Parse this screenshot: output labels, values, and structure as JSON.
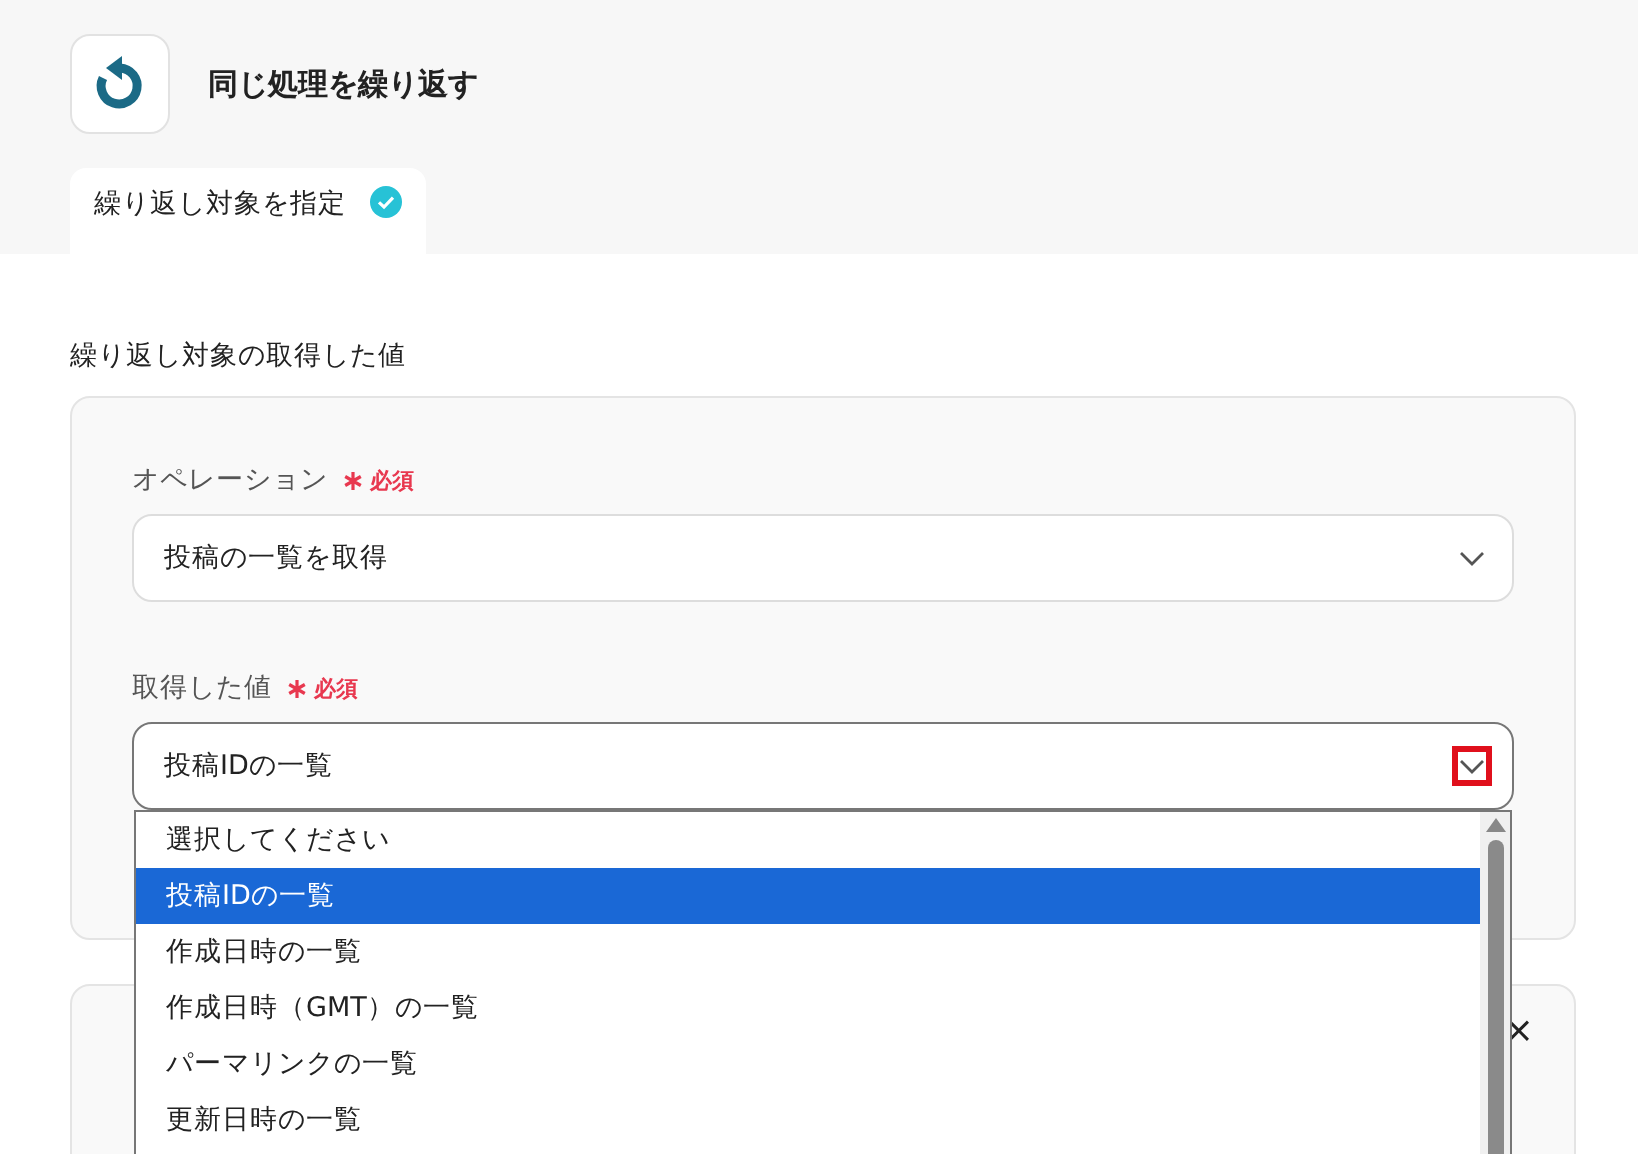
{
  "header": {
    "title": "同じ処理を繰り返す"
  },
  "tabs": [
    {
      "label": "繰り返し対象を指定",
      "selected": true,
      "completed": true
    }
  ],
  "section": {
    "title": "繰り返し対象の取得した値"
  },
  "fields": [
    {
      "label": "オペレーション",
      "required": "必須",
      "value": "投稿の一覧を取得",
      "open": false
    },
    {
      "label": "取得した値",
      "required": "必須",
      "value": "投稿IDの一覧",
      "open": true
    }
  ],
  "dropdown": {
    "options": [
      {
        "label": "選択してください",
        "selected": false
      },
      {
        "label": "投稿IDの一覧",
        "selected": true
      },
      {
        "label": "作成日時の一覧",
        "selected": false
      },
      {
        "label": "作成日時（GMT）の一覧",
        "selected": false
      },
      {
        "label": "パーマリンクの一覧",
        "selected": false
      },
      {
        "label": "更新日時の一覧",
        "selected": false
      }
    ]
  },
  "close_label": "×"
}
